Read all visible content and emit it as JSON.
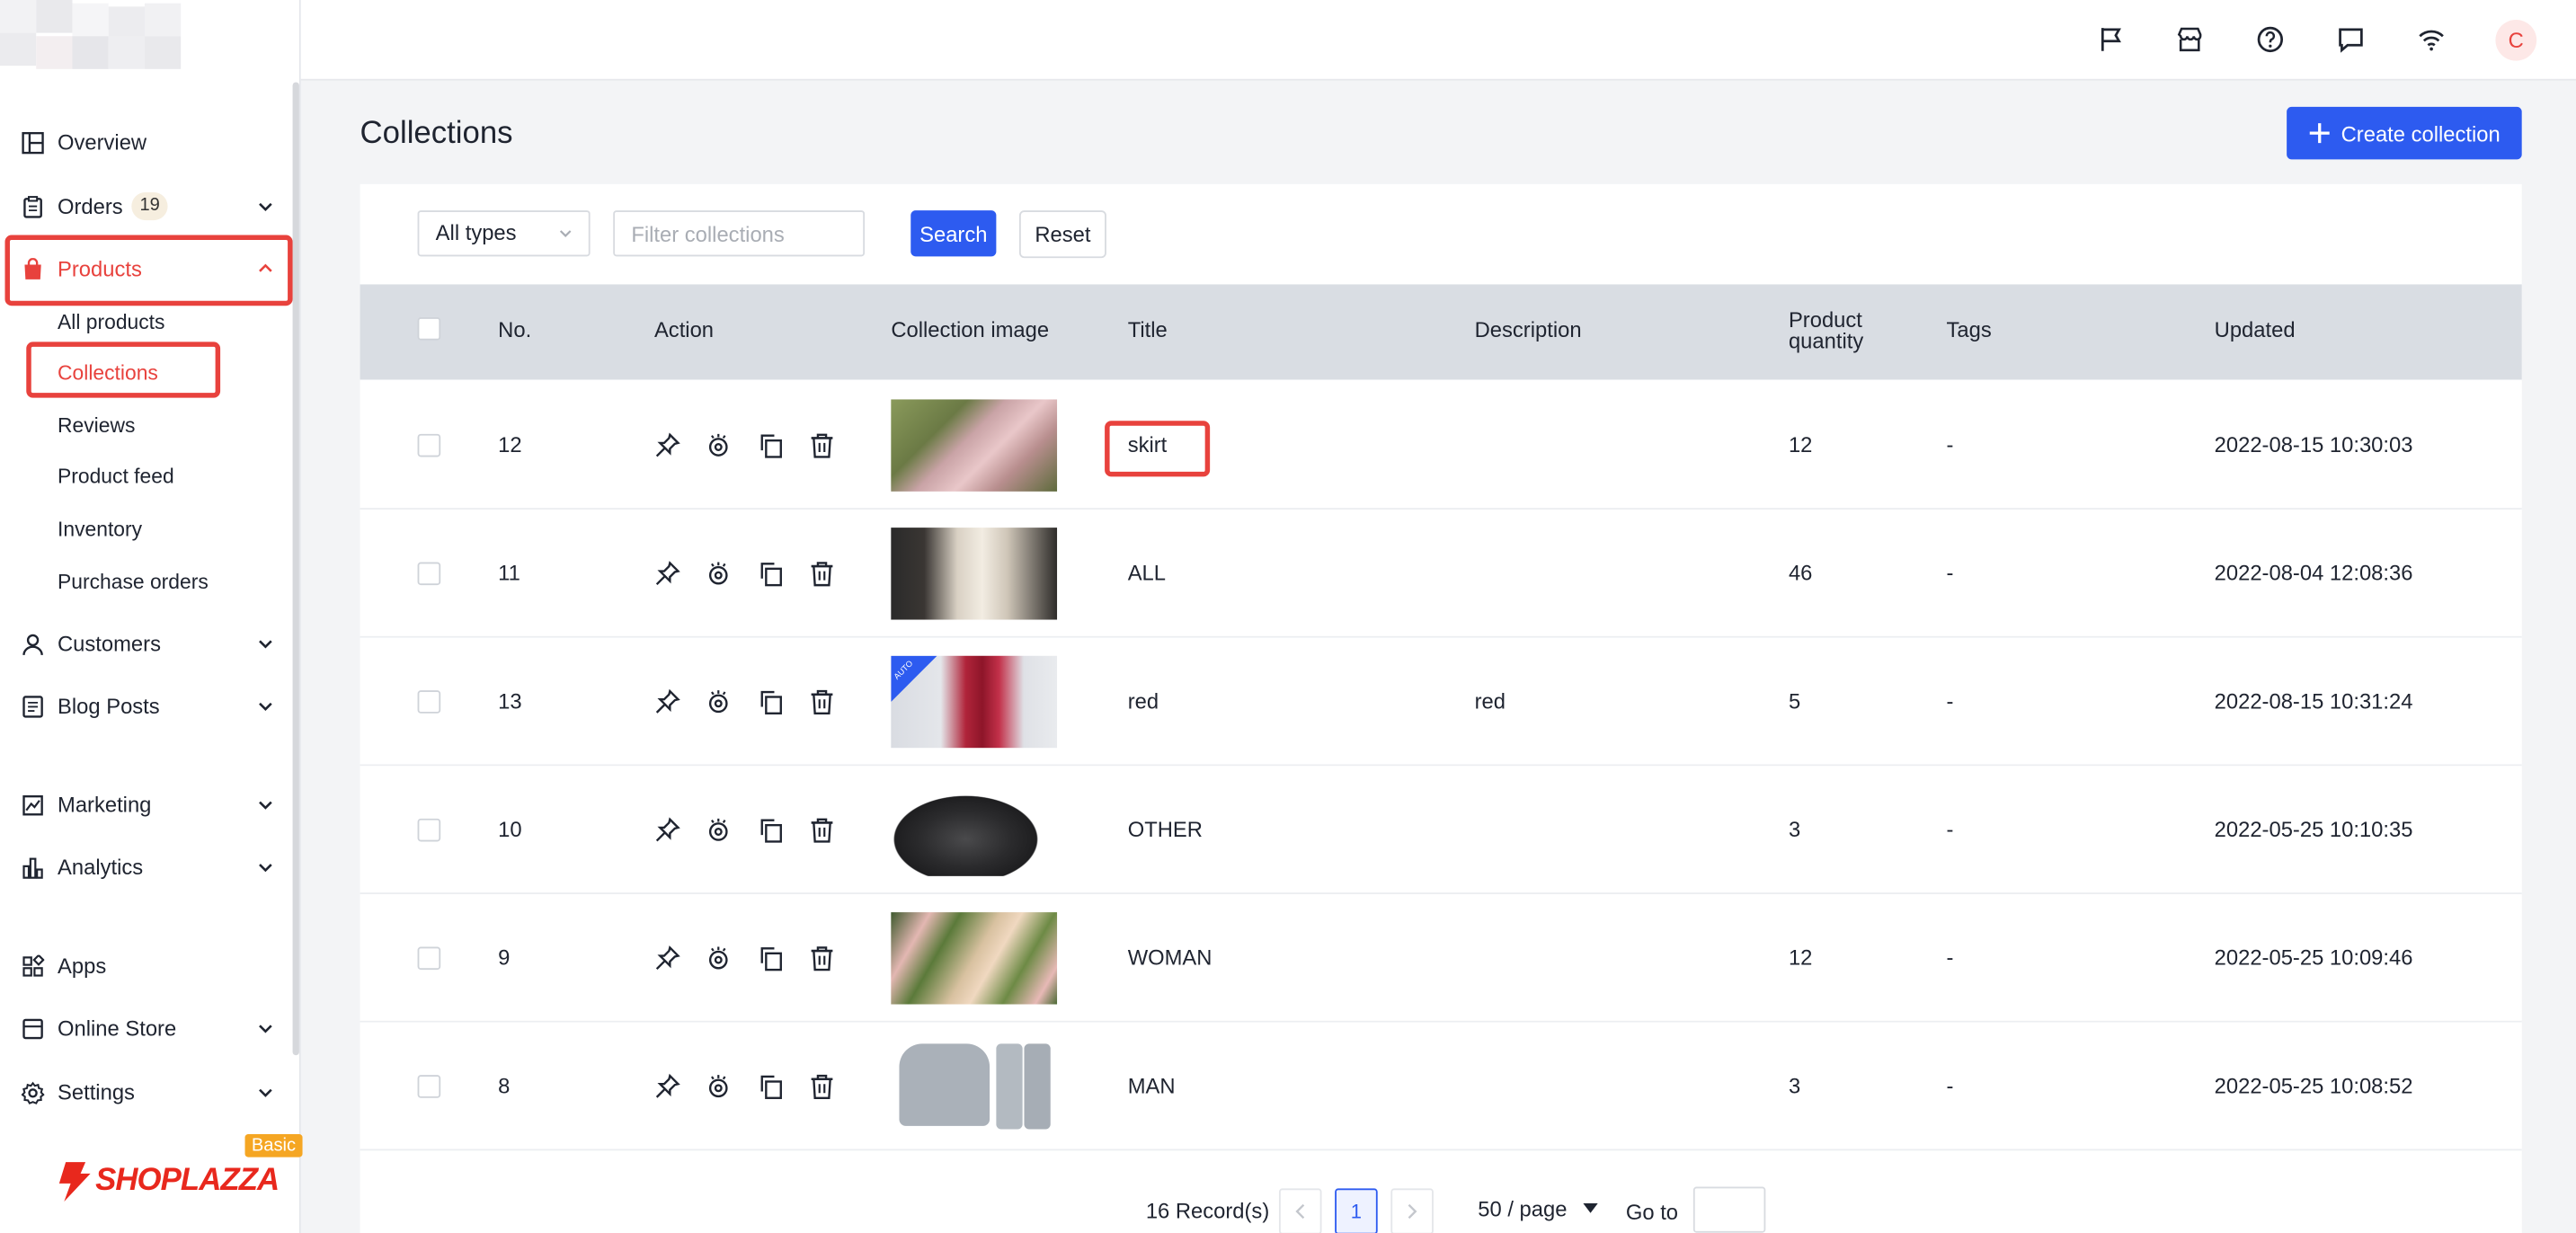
{
  "sidebar": {
    "items": [
      {
        "label": "Overview",
        "icon": "overview-icon"
      },
      {
        "label": "Orders",
        "badge": "19",
        "icon": "orders-icon"
      },
      {
        "label": "Products",
        "icon": "products-icon"
      },
      {
        "label": "Customers",
        "icon": "customers-icon"
      },
      {
        "label": "Blog Posts",
        "icon": "blog-icon"
      },
      {
        "label": "Marketing",
        "icon": "marketing-icon"
      },
      {
        "label": "Analytics",
        "icon": "analytics-icon"
      },
      {
        "label": "Apps",
        "icon": "apps-icon"
      },
      {
        "label": "Online Store",
        "icon": "store-icon"
      },
      {
        "label": "Settings",
        "icon": "gear-icon"
      }
    ],
    "product_subitems": [
      "All products",
      "Collections",
      "Reviews",
      "Product feed",
      "Inventory",
      "Purchase orders"
    ],
    "plan_tag": "Basic",
    "brand": "SHOPLAZZA"
  },
  "topbar": {
    "icons": [
      "flag-icon",
      "store-icon",
      "help-icon",
      "chat-icon",
      "wifi-icon"
    ],
    "avatar_initial": "C"
  },
  "page": {
    "title": "Collections",
    "create_label": "Create collection"
  },
  "filters": {
    "type_value": "All types",
    "search_placeholder": "Filter collections",
    "search_label": "Search",
    "reset_label": "Reset"
  },
  "table": {
    "headers": {
      "no": "No.",
      "action": "Action",
      "image": "Collection image",
      "title": "Title",
      "description": "Description",
      "qty_line1": "Product",
      "qty_line2": "quantity",
      "tags": "Tags",
      "updated": "Updated"
    },
    "rows": [
      {
        "no": "12",
        "title": "skirt",
        "description": "",
        "qty": "12",
        "tags": "-",
        "updated": "2022-08-15 10:30:03"
      },
      {
        "no": "11",
        "title": "ALL",
        "description": "",
        "qty": "46",
        "tags": "-",
        "updated": "2022-08-04 12:08:36"
      },
      {
        "no": "13",
        "title": "red",
        "description": "red",
        "qty": "5",
        "tags": "-",
        "updated": "2022-08-15 10:31:24",
        "image_badge": "AUTO"
      },
      {
        "no": "10",
        "title": "OTHER",
        "description": "",
        "qty": "3",
        "tags": "-",
        "updated": "2022-05-25 10:10:35"
      },
      {
        "no": "9",
        "title": "WOMAN",
        "description": "",
        "qty": "12",
        "tags": "-",
        "updated": "2022-05-25 10:09:46"
      },
      {
        "no": "8",
        "title": "MAN",
        "description": "",
        "qty": "3",
        "tags": "-",
        "updated": "2022-05-25 10:08:52"
      }
    ]
  },
  "pagination": {
    "records": "16 Record(s)",
    "current_page": "1",
    "page_size": "50 / page",
    "goto_label": "Go to"
  },
  "colors": {
    "accent": "#2d5bf0",
    "highlight": "#e8423d",
    "header_bg": "#d9dde3"
  }
}
